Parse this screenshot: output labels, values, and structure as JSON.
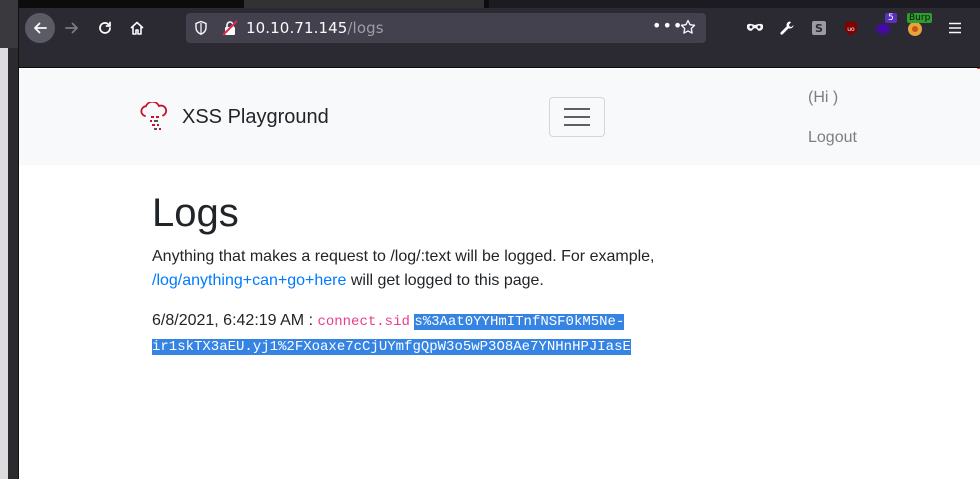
{
  "browser": {
    "url_host": "10.10.71.145",
    "url_path": "/logs",
    "extensions": {
      "wappalyzer_badge": "5",
      "burp_badge": "Burp"
    }
  },
  "navbar": {
    "brand": "XSS Playground",
    "greeting": "(Hi )",
    "logout": "Logout"
  },
  "main": {
    "title": "Logs",
    "intro_text": "Anything that makes a request to /log/:text will be logged. For example,",
    "example_link": "/log/anything+can+go+here",
    "intro_suffix": " will get logged to this page.",
    "log_entries": [
      {
        "timestamp": "6/8/2021, 6:42:19 AM : ",
        "name": "connect.sid",
        "value": "s%3Aat0YYHmITnfNSF0kM5Ne-ir1skTX3aEU.yj1%2FXoaxe7cCjUYmfgQpW3o5wP3O8Ae7YNHnHPJIasE"
      }
    ]
  },
  "colors": {
    "toolbar_bg": "#2b2a33",
    "link": "#007bff",
    "code_pink": "#e83e8c",
    "selection": "#3584e4"
  }
}
